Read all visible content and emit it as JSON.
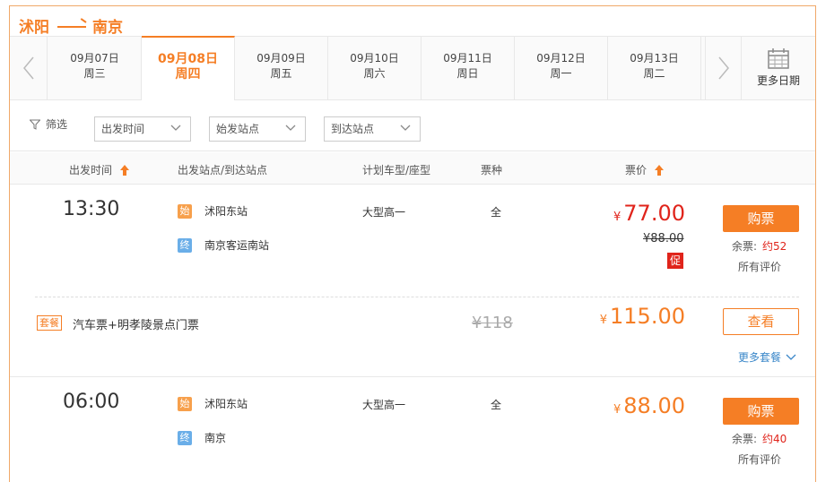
{
  "route": {
    "from": "沭阳",
    "to": "南京"
  },
  "dates": [
    {
      "date": "09月07日",
      "weekday": "周三",
      "active": false
    },
    {
      "date": "09月08日",
      "weekday": "周四",
      "active": true
    },
    {
      "date": "09月09日",
      "weekday": "周五",
      "active": false
    },
    {
      "date": "09月10日",
      "weekday": "周六",
      "active": false
    },
    {
      "date": "09月11日",
      "weekday": "周日",
      "active": false
    },
    {
      "date": "09月12日",
      "weekday": "周一",
      "active": false
    },
    {
      "date": "09月13日",
      "weekday": "周二",
      "active": false
    }
  ],
  "more_dates_label": "更多日期",
  "filters": {
    "label": "筛选",
    "depart_time": "出发时间",
    "start_station": "始发站点",
    "arrive_station": "到达站点"
  },
  "table_header": {
    "depart_time": "出发时间",
    "stations": "出发站点/到达站点",
    "vehicle": "计划车型/座型",
    "ticket_type": "票种",
    "price": "票价"
  },
  "trips": [
    {
      "time": "13:30",
      "start_badge": "始",
      "start": "沭阳东站",
      "end_badge": "终",
      "end": "南京客运南站",
      "vehicle": "大型高一",
      "ticket_type": "全",
      "currency": "¥",
      "price": "77.00",
      "original_price": "¥88.00",
      "promo": "促",
      "buy_label": "购票",
      "remaining_label": "余票:",
      "remaining": "约52",
      "eval_label": "所有评价"
    },
    {
      "time": "06:00",
      "start_badge": "始",
      "start": "沭阳东站",
      "end_badge": "终",
      "end": "南京",
      "vehicle": "大型高一",
      "ticket_type": "全",
      "currency": "¥",
      "price": "88.00",
      "buy_label": "购票",
      "remaining_label": "余票:",
      "remaining": "约40",
      "eval_label": "所有评价"
    }
  ],
  "package": {
    "tag": "套餐",
    "name": "汽车票+明孝陵景点门票",
    "original_price": "¥118",
    "currency": "¥",
    "price": "115.00",
    "view_label": "查看",
    "more_label": "更多套餐"
  },
  "colors": {
    "accent": "#f57e25",
    "price_red": "#e0241b",
    "link_blue": "#3a87c9"
  }
}
